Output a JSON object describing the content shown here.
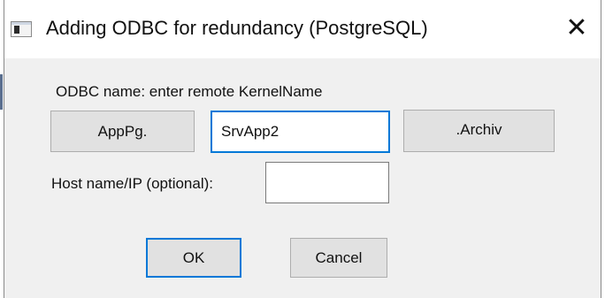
{
  "window": {
    "title": "Adding ODBC for redundancy (PostgreSQL)",
    "close_glyph": "✕",
    "app_icon": "window-icon"
  },
  "odbc": {
    "label": "ODBC name: enter remote KernelName",
    "prefix_button": "AppPg.",
    "name_value": "SrvApp2",
    "suffix_button": ".Archiv"
  },
  "host": {
    "label": "Host name/IP (optional):",
    "value": ""
  },
  "buttons": {
    "ok": "OK",
    "cancel": "Cancel"
  },
  "colors": {
    "focus_accent": "#0078d7",
    "dialog_background": "#f0f0f0",
    "button_face": "#e1e1e1"
  }
}
